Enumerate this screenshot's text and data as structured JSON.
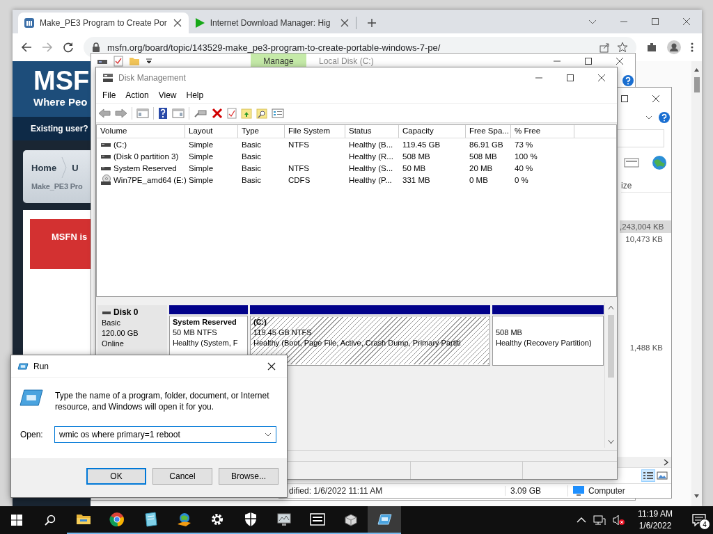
{
  "browser": {
    "tabs": [
      {
        "title": "Make_PE3 Program to Create Por",
        "kind": "site",
        "selected": true
      },
      {
        "title": "Internet Download Manager: Hig",
        "kind": "play",
        "selected": false
      }
    ],
    "url": "msfn.org/board/topic/143529-make_pe3-program-to-create-portable-windows-7-pe/",
    "page": {
      "logo": "MSF",
      "tagline": "Where Peo",
      "signin": "Existing user?",
      "breadcrumbs": [
        "Home",
        "U"
      ],
      "topic": "Make_PE3 Pro",
      "notice": "MSFN is"
    }
  },
  "explorer_back": {
    "ribbon_tab": "Manage",
    "title": "Local Disk (C:)"
  },
  "explorer_front": {
    "column": "ize",
    "rows": [
      {
        "size": ",243,004 KB",
        "selected": true
      },
      {
        "size": "10,473 KB",
        "selected": false
      },
      {
        "size": "1,488 KB",
        "selected": false
      }
    ],
    "views": [
      {
        "kind": "details",
        "selected": true
      },
      {
        "kind": "tiles",
        "selected": false
      }
    ],
    "status": {
      "modified": "dified: 1/6/2022 11:11 AM",
      "size": "3.09 GB",
      "location": "Computer"
    }
  },
  "disk_management": {
    "title": "Disk Management",
    "menu": [
      "File",
      "Action",
      "View",
      "Help"
    ],
    "columns": [
      "Volume",
      "Layout",
      "Type",
      "File System",
      "Status",
      "Capacity",
      "Free Spa...",
      "% Free"
    ],
    "rows": [
      {
        "kind": "disk",
        "volume": "(C:)",
        "layout": "Simple",
        "type": "Basic",
        "file_system": "NTFS",
        "status": "Healthy (B...",
        "capacity": "119.45 GB",
        "free_space": "86.91 GB",
        "percent_free": "73 %"
      },
      {
        "kind": "disk",
        "volume": "(Disk 0 partition 3)",
        "layout": "Simple",
        "type": "Basic",
        "status": "Healthy (R...",
        "capacity": "508 MB",
        "free_space": "508 MB",
        "percent_free": "100 %"
      },
      {
        "kind": "disk",
        "volume": "System Reserved",
        "layout": "Simple",
        "type": "Basic",
        "file_system": "NTFS",
        "status": "Healthy (S...",
        "capacity": "50 MB",
        "free_space": "20 MB",
        "percent_free": "40 %"
      },
      {
        "kind": "disc",
        "volume": "Win7PE_amd64 (E:)",
        "layout": "Simple",
        "type": "Basic",
        "file_system": "CDFS",
        "status": "Healthy (P...",
        "capacity": "331 MB",
        "free_space": "0 MB",
        "percent_free": "0 %"
      }
    ],
    "disk": {
      "name": "Disk 0",
      "type": "Basic",
      "size": "120.00 GB",
      "state": "Online"
    },
    "partitions": [
      {
        "name": "System Reserved",
        "size": "50 MB NTFS",
        "status": "Healthy (System, F",
        "selected": false
      },
      {
        "name": "(C:)",
        "size": "119.45 GB NTFS",
        "status": "Healthy (Boot, Page File, Active, Crash Dump, Primary Partiti",
        "selected": true
      },
      {
        "size": "508 MB",
        "status": "Healthy (Recovery Partition)",
        "selected": false
      }
    ]
  },
  "run": {
    "title": "Run",
    "message": "Type the name of a program, folder, document, or Internet resource, and Windows will open it for you.",
    "label": "Open:",
    "value": "wmic os where primary=1 reboot",
    "buttons": [
      {
        "label": "OK",
        "default": true
      },
      {
        "label": "Cancel",
        "default": false
      },
      {
        "label": "Browse...",
        "default": false
      }
    ]
  },
  "taskbar": {
    "apps": [
      {
        "kind": "folder",
        "running": true,
        "active": false
      },
      {
        "kind": "browser",
        "running": true,
        "active": false
      },
      {
        "kind": "notepad",
        "running": true,
        "active": false
      },
      {
        "kind": "download",
        "running": true,
        "active": false
      },
      {
        "kind": "settings",
        "running": true,
        "active": false
      },
      {
        "kind": "shield",
        "running": true,
        "active": false
      },
      {
        "kind": "monitor",
        "running": true,
        "active": false
      },
      {
        "kind": "archive",
        "running": true,
        "active": false
      },
      {
        "kind": "package",
        "running": true,
        "active": false
      },
      {
        "kind": "run",
        "running": true,
        "active": true
      }
    ],
    "volume_muted": true,
    "time": "11:19 AM",
    "date": "1/6/2022",
    "notifications": "4"
  }
}
